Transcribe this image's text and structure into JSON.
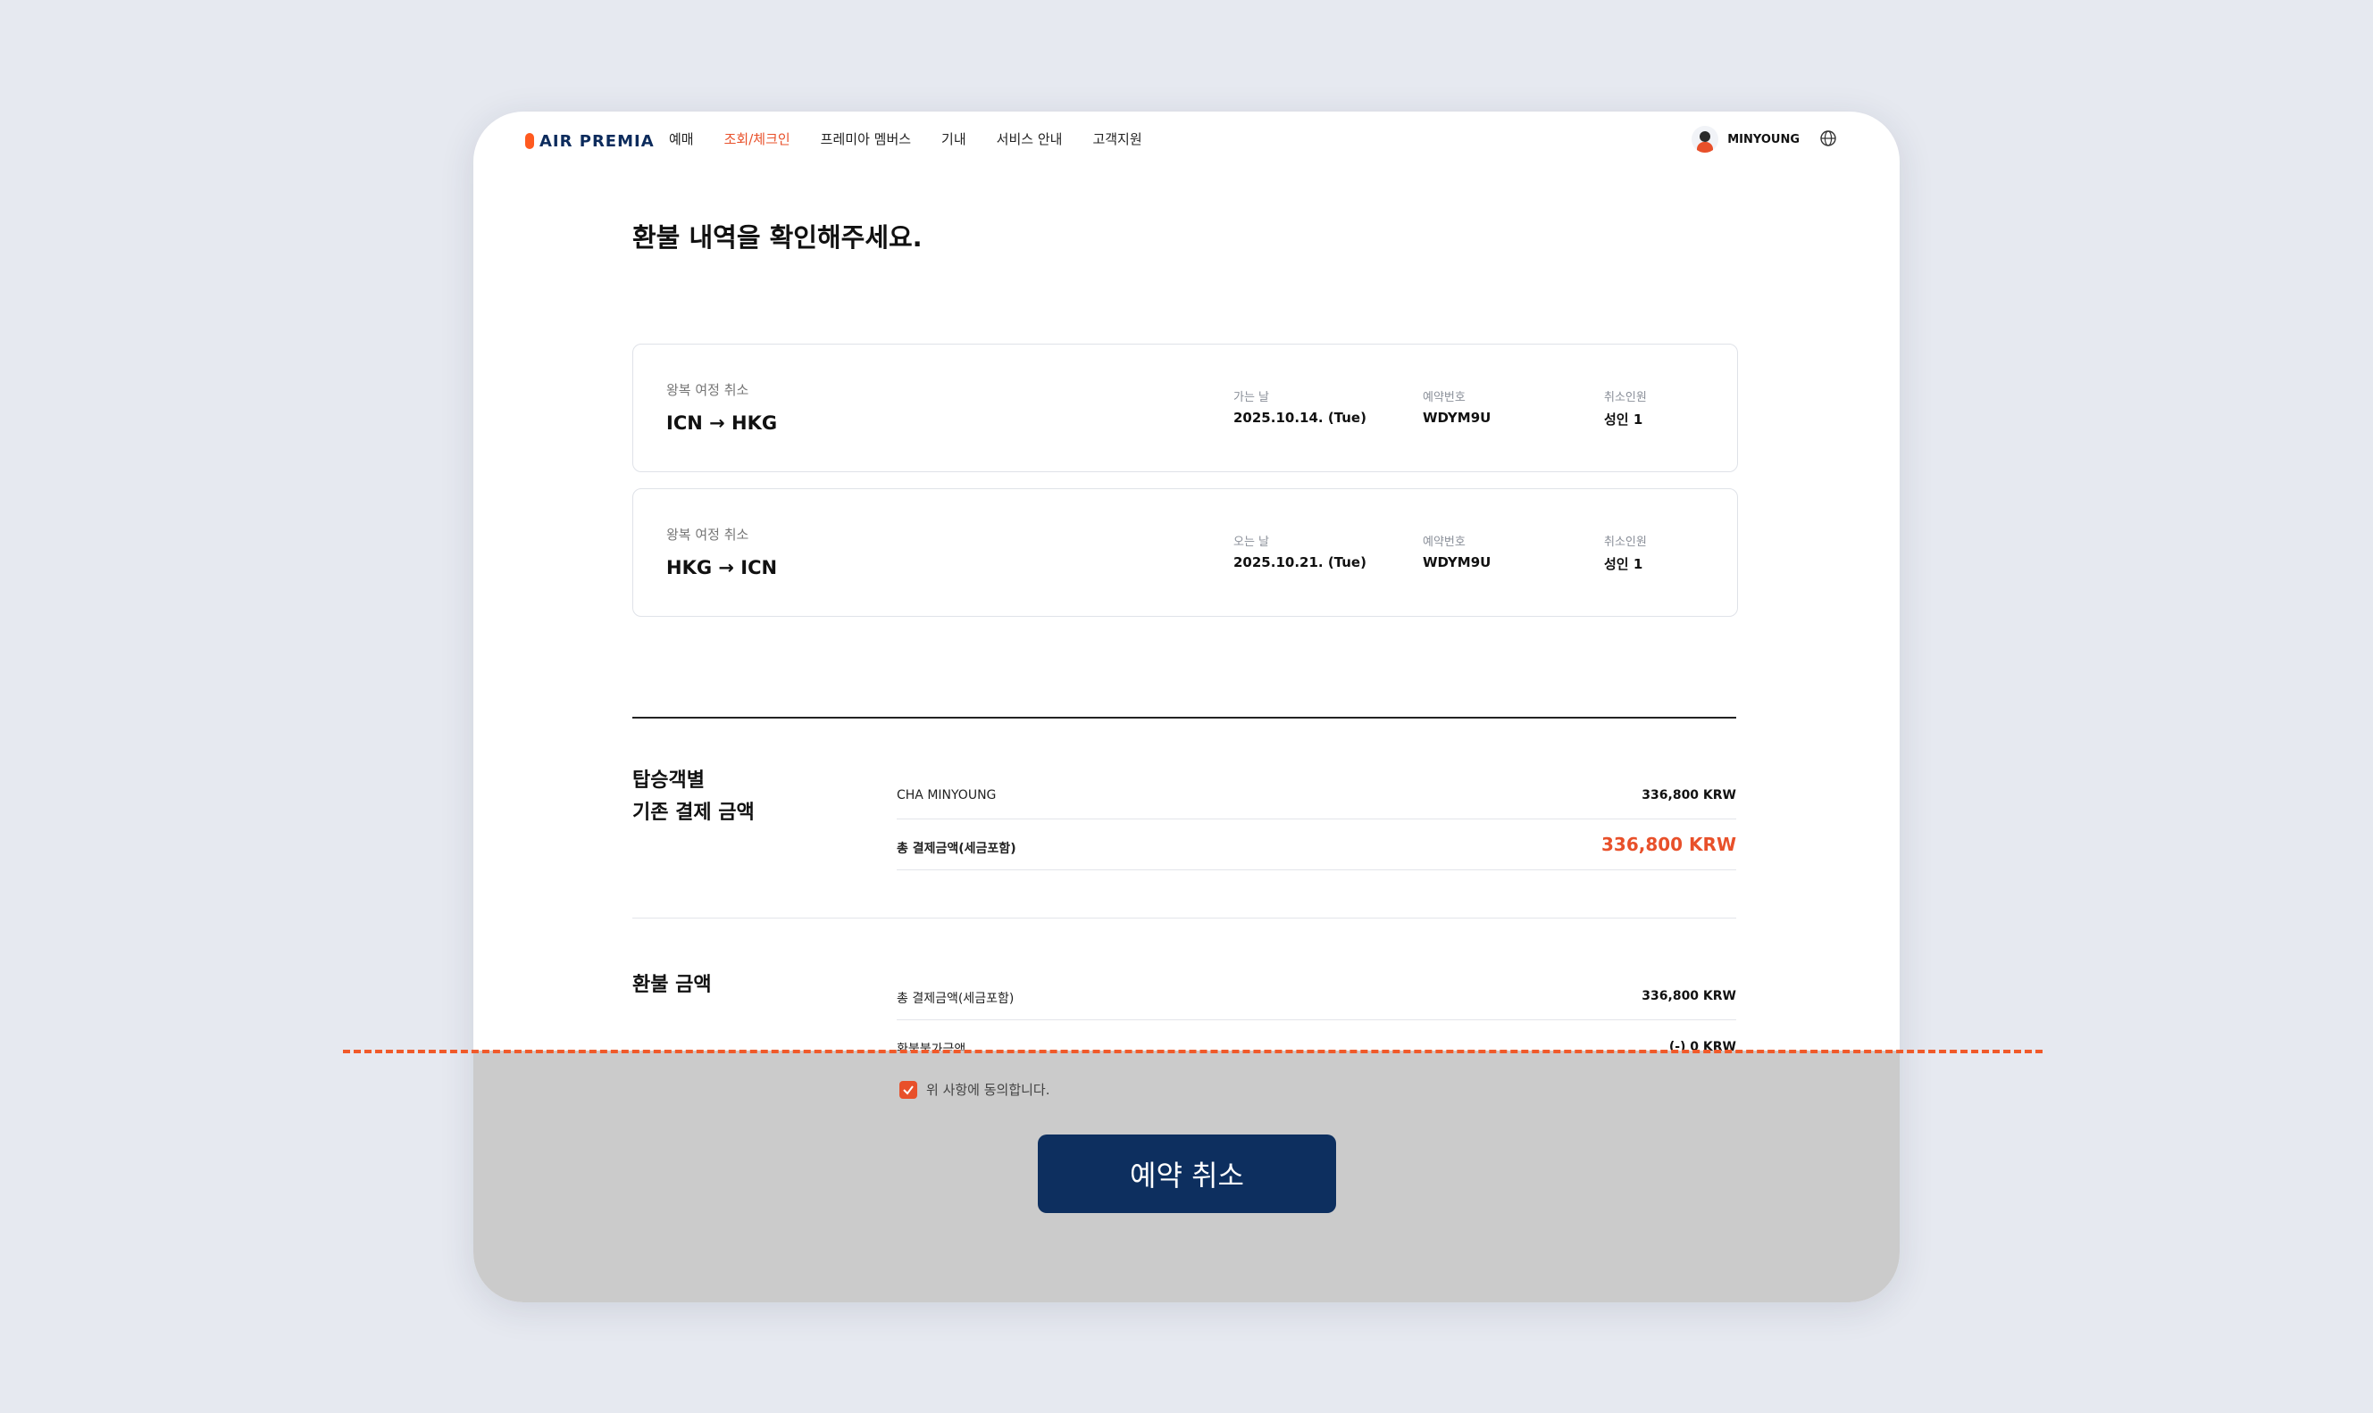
{
  "header": {
    "logo_text": "AIR PREMIA",
    "nav": [
      "예매",
      "조회/체크인",
      "프레미아 멤버스",
      "기내",
      "서비스 안내",
      "고객지원"
    ],
    "active_nav_index": 1,
    "user_name": "MINYOUNG"
  },
  "page_title": "환불 내역을 확인해주세요.",
  "trips": [
    {
      "kind": "왕복 여정 취소",
      "route": "ICN → HKG",
      "date_label": "가는 날",
      "date": "2025.10.14. (Tue)",
      "booking_label": "예약번호",
      "booking": "WDYM9U",
      "cancel_label": "취소인원",
      "cancel": "성인 1"
    },
    {
      "kind": "왕복 여정 취소",
      "route": "HKG → ICN",
      "date_label": "오는 날",
      "date": "2025.10.21. (Tue)",
      "booking_label": "예약번호",
      "booking": "WDYM9U",
      "cancel_label": "취소인원",
      "cancel": "성인 1"
    }
  ],
  "payment": {
    "title_line1": "탑승객별",
    "title_line2": "기존 결제 금액",
    "passenger": "CHA MINYOUNG",
    "passenger_amount": "336,800 KRW",
    "total_label": "총 결제금액(세금포함)",
    "total_amount": "336,800 KRW"
  },
  "refund": {
    "title": "환불 금액",
    "total_label": "총 결제금액(세금포함)",
    "total_amount": "336,800 KRW",
    "nonrefundable_label": "환불불가금액",
    "nonrefundable_amount": "(-) 0 KRW"
  },
  "agree_text": "위 사항에 동의합니다.",
  "cancel_button": "예약 취소",
  "colors": {
    "accent": "#e8502a",
    "primary": "#0d2f5f",
    "dashed_line": "#f05a2a"
  }
}
